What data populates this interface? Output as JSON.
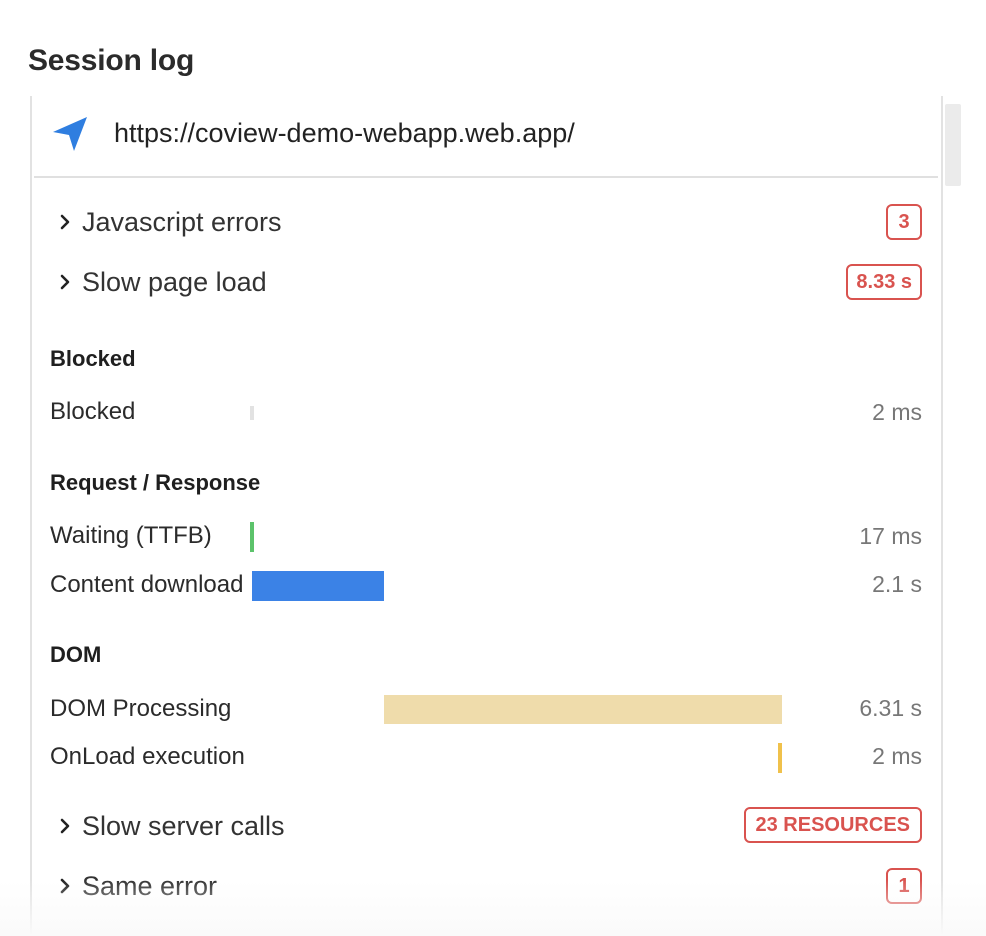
{
  "header": {
    "title": "Session log"
  },
  "navigation": {
    "url": "https://coview-demo-webapp.web.app/",
    "icon": "navigation-arrow-icon"
  },
  "sections": [
    {
      "label": "Javascript errors",
      "badge": "3"
    },
    {
      "label": "Slow page load",
      "badge": "8.33 s"
    }
  ],
  "timing": {
    "blocked_group": "Blocked",
    "blocked": {
      "label": "Blocked",
      "value": "2 ms"
    },
    "request_group": "Request / Response",
    "waiting": {
      "label": "Waiting (TTFB)",
      "value": "17 ms"
    },
    "download": {
      "label": "Content download",
      "value": "2.1 s"
    },
    "dom_group": "DOM",
    "dom_processing": {
      "label": "DOM Processing",
      "value": "6.31 s"
    },
    "onload": {
      "label": "OnLoad execution",
      "value": "2 ms"
    }
  },
  "footer_sections": [
    {
      "label": "Slow server calls",
      "badge": "23 RESOURCES"
    },
    {
      "label": "Same error",
      "badge": "1"
    }
  ],
  "colors": {
    "accent": "#2f7ee0",
    "error": "#d9534f",
    "ttfb": "#5cc36b",
    "download": "#3b82e6",
    "dom_processing": "#efdcab",
    "onload": "#f0c14b",
    "blocked": "#e2e2e2"
  }
}
